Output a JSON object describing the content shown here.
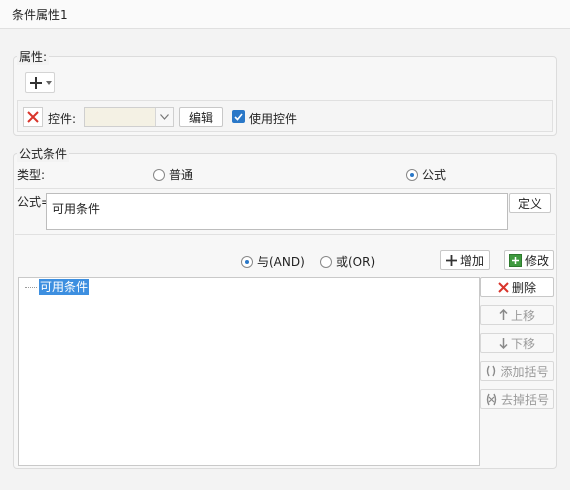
{
  "window": {
    "title": "条件属性1"
  },
  "properties": {
    "group_label": "属性:",
    "control_label": "控件:",
    "edit_button": "编辑",
    "use_control_label": "使用控件",
    "use_control_checked": true
  },
  "formula_condition": {
    "group_label": "公式条件",
    "type_label": "类型:",
    "type_options": [
      "普通",
      "公式"
    ],
    "type_selected": "公式",
    "formula_label": "公式=",
    "formula_value": "可用条件",
    "define_button": "定义"
  },
  "logic": {
    "and_label": "与(AND)",
    "or_label": "或(OR)",
    "selected": "与(AND)",
    "add_button": "增加",
    "modify_button": "修改"
  },
  "condition_list": {
    "items": [
      "可用条件"
    ]
  },
  "side_buttons": {
    "delete": "删除",
    "move_up": "上移",
    "move_down": "下移",
    "add_parens": "添加括号",
    "remove_parens": "去掉括号"
  },
  "colors": {
    "accent": "#2a78c8",
    "delete_red": "#d9342b",
    "selection": "#3d8fe0"
  }
}
